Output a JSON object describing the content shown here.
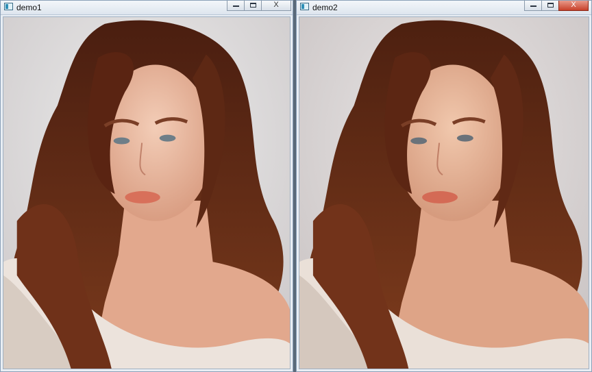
{
  "windows": [
    {
      "title": "demo1",
      "image": "portrait-photo",
      "controls": [
        "minimize-icon",
        "maximize-icon",
        "close-icon"
      ]
    },
    {
      "title": "demo2",
      "image": "portrait-photo-smoothed",
      "controls": [
        "minimize-icon",
        "maximize-icon",
        "close-icon"
      ]
    }
  ],
  "close_glyph": "X",
  "colors": {
    "background_wall": "#dcdcdc",
    "hair": "#6a2f17",
    "skin": "#e8b59a",
    "sweater": "#ece3dc"
  }
}
